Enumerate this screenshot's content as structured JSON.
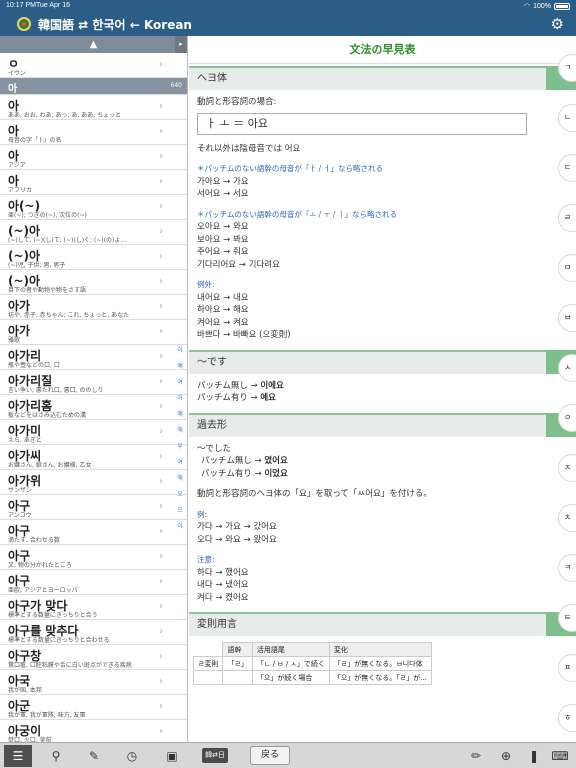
{
  "status": {
    "time": "10:17 PM",
    "day": "Tue Apr 16",
    "battery": "100%"
  },
  "header": {
    "title": "韓国語 ⇄ 한국어 ← Korean"
  },
  "list": {
    "top_arrow": "▲",
    "first": {
      "head": "ㅇ",
      "gloss": "イウン"
    },
    "selected": {
      "head": "아",
      "count": "640"
    },
    "entries": [
      {
        "head": "아",
        "gloss": "ああ, おお, わあ; あっ; あ, ああ, ちょっと"
      },
      {
        "head": "아",
        "gloss": "母音の字「ㅏ」の名"
      },
      {
        "head": "아",
        "gloss": "アジア"
      },
      {
        "head": "아",
        "gloss": "アフリカ"
      },
      {
        "head": "아(~)",
        "gloss": "亜(~); つぎの(~), 次位の(~)"
      },
      {
        "head": "(~)아",
        "gloss": "(~)して, (~)(し)て; (~)(し)く; (~)(の)よ..."
      },
      {
        "head": "(~)아",
        "gloss": "(~)児, 子供; 男, 男子"
      },
      {
        "head": "(~)아",
        "gloss": "目下の者や動物や物をさす語"
      },
      {
        "head": "아가",
        "gloss": "坊や, 赤子, 赤ちゃん; これ, ちょっと, あなた"
      },
      {
        "head": "아가",
        "gloss": "雅歌"
      },
      {
        "head": "아가리",
        "gloss": "瓶や壺などの口; 口"
      },
      {
        "head": "아가리질",
        "gloss": "言い争い; 悪たれ口, 悪口, ののしり"
      },
      {
        "head": "아가리홈",
        "gloss": "板などをはさみ込むための溝"
      },
      {
        "head": "아가미",
        "gloss": "えら, あぎと"
      },
      {
        "head": "아가씨",
        "gloss": "お嬢さん, 娘さん, お嬢様; 乙女"
      },
      {
        "head": "아가위",
        "gloss": "サンザシ"
      },
      {
        "head": "아구",
        "gloss": "アンコウ"
      },
      {
        "head": "아구",
        "gloss": "満たす, 合わせる数"
      },
      {
        "head": "아구",
        "gloss": "叉; 物の分かれたところ"
      },
      {
        "head": "아구",
        "gloss": "亜欧; アジアとヨーロッパ"
      },
      {
        "head": "아구가 맞다",
        "gloss": "標準とする数量にきっちりと合う"
      },
      {
        "head": "아구를 맞추다",
        "gloss": "標準とする数量にきっちりと合わせる"
      },
      {
        "head": "아구창",
        "gloss": "鵞口瘡, 口腔粘膜や舌に白い斑点ができる疾病"
      },
      {
        "head": "아국",
        "gloss": "我が国, 本邦"
      },
      {
        "head": "아군",
        "gloss": "我が軍, 我が軍隊; 味方, 友軍"
      },
      {
        "head": "아궁이",
        "gloss": "焚口, 火口, 釜前"
      }
    ],
    "index_letters": [
      "이",
      "예",
      "여",
      "어",
      "예",
      "에",
      "우",
      "여",
      "에",
      "오",
      "으",
      "이"
    ]
  },
  "panel": {
    "title": "文法の早見表",
    "s1": {
      "header": "ヘヨ体",
      "intro": "動詞と形容詞の場合:",
      "box": "ㅏ ㅗ ＝ 아요",
      "else": "それ以外は陰母音では 어요",
      "note1": "＊パッチムのない語幹の母音が「ㅏ / ㅓ」なら略される",
      "ex1": [
        "가아요 → 가요",
        "서어요 → 서요"
      ],
      "note2": "＊パッチムのない語幹の母音が「ㅗ / ㅜ / ㅣ」なら略される",
      "ex2": [
        "오아요 → 와요",
        "보아요 → 봐요",
        "주어요 → 줘요",
        "기다리어요 → 기다려요"
      ],
      "exc_label": "例外:",
      "exc": [
        "내어요 → 내요",
        "하아요 → 해요",
        "켜어요 → 켜요",
        "바쁘다 → 바빠요 (으変則)"
      ]
    },
    "s2": {
      "header": "～です",
      "lines": [
        {
          "pre": "パッチム無し → ",
          "bold": "이에요"
        },
        {
          "pre": "パッチム有り → ",
          "bold": "예요"
        }
      ]
    },
    "s3": {
      "header": "過去形",
      "intro": "～でした",
      "lines": [
        {
          "pre": "パッチム無し → ",
          "bold": "였어요"
        },
        {
          "pre": "パッチム有り → ",
          "bold": "이었요"
        }
      ],
      "rule": "動詞と形容詞のヘヨ体の「요」を取って「ㅆ어요」を付ける。",
      "ex_label": "例:",
      "ex": [
        "가다 → 가요 → 갔어요",
        "오다 → 와요 → 왔어요"
      ],
      "att_label": "注意:",
      "att": [
        "하다 → 했어요",
        "내다 → 냈어요",
        "켜다 → 켰어요"
      ]
    },
    "s4": {
      "header": "変則用言",
      "cols": [
        "語幹",
        "活用語尾",
        "変化"
      ],
      "rows": [
        {
          "side": "ㄹ変則",
          "stem": "「ㄹ」",
          "end": "「ㄴ / ㅂ / ㅅ」で続く",
          "change": "「ㄹ」が無くなる。ㅂ니다体"
        },
        {
          "side": "",
          "stem": "",
          "end": "「으」が続く場合",
          "change": "「으」が無くなる。「ㄹ」が..."
        },
        {
          "side": "",
          "stem": "",
          "end": "...",
          "change": "..."
        }
      ]
    }
  },
  "tabs": [
    "ㄱ",
    "ㄴ",
    "ㄷ",
    "ㄹ",
    "ㅁ",
    "ㅂ",
    "ㅅ",
    "ㅇ",
    "ㅈ",
    "ㅊ",
    "ㅋ",
    "ㅌ",
    "ㅍ",
    "ㅎ"
  ],
  "toolbar": {
    "back": "戻る",
    "small": "韓⇄日"
  }
}
